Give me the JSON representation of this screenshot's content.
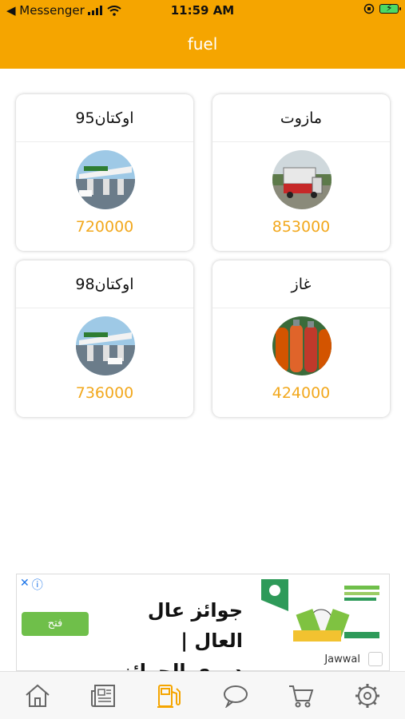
{
  "status_bar": {
    "back_label": "◀ Messenger",
    "time": "11:59 AM"
  },
  "header": {
    "title": "fuel"
  },
  "fuels": [
    {
      "name": "مازوت",
      "price": "853000",
      "image": "truck-image"
    },
    {
      "name": "اوكتان95",
      "price": "720000",
      "image": "gas-station-image"
    },
    {
      "name": "غاز",
      "price": "424000",
      "image": "gas-cylinders-image"
    },
    {
      "name": "اوكتان98",
      "price": "736000",
      "image": "gas-station-image"
    }
  ],
  "ad": {
    "headline_line1": "جوائز عال العال |",
    "headline_line2": "دوري الجوائز",
    "open_label": "فتح",
    "brand": "Jawwal"
  },
  "tabbar": {
    "items": [
      "home-icon",
      "news-icon",
      "fuel-pump-icon",
      "chat-icon",
      "cart-icon",
      "settings-icon"
    ],
    "active": "fuel-pump-icon",
    "active_color": "#f5a500",
    "inactive_color": "#666666"
  },
  "colors": {
    "accent": "#f5a500",
    "price": "#f2a81d"
  }
}
